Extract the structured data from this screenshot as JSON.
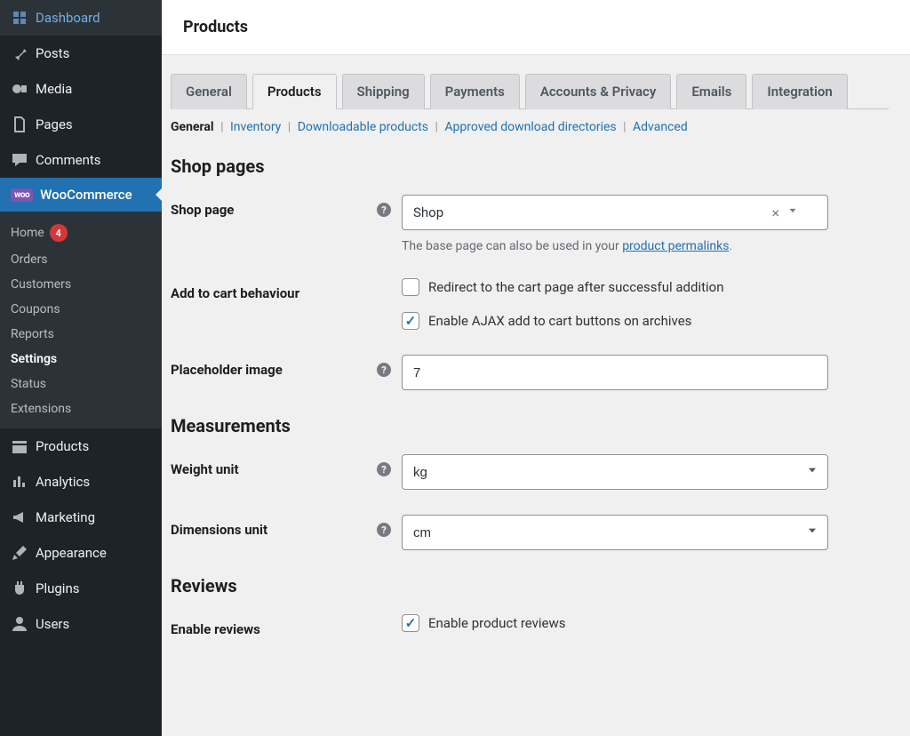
{
  "sidebar": {
    "items": [
      {
        "label": "Dashboard",
        "icon": "dashboard"
      },
      {
        "label": "Posts",
        "icon": "pin"
      },
      {
        "label": "Media",
        "icon": "media"
      },
      {
        "label": "Pages",
        "icon": "pages"
      },
      {
        "label": "Comments",
        "icon": "comment"
      },
      {
        "label": "WooCommerce",
        "icon": "woo",
        "active": true
      },
      {
        "label": "Products",
        "icon": "products"
      },
      {
        "label": "Analytics",
        "icon": "analytics"
      },
      {
        "label": "Marketing",
        "icon": "marketing"
      },
      {
        "label": "Appearance",
        "icon": "appearance"
      },
      {
        "label": "Plugins",
        "icon": "plugins"
      },
      {
        "label": "Users",
        "icon": "users"
      }
    ],
    "woo_badge": "woo",
    "submenu": {
      "home": "Home",
      "home_badge": "4",
      "orders": "Orders",
      "customers": "Customers",
      "coupons": "Coupons",
      "reports": "Reports",
      "settings": "Settings",
      "status": "Status",
      "extensions": "Extensions"
    }
  },
  "header": {
    "title": "Products"
  },
  "tabs": {
    "general": "General",
    "products": "Products",
    "shipping": "Shipping",
    "payments": "Payments",
    "accounts": "Accounts & Privacy",
    "emails": "Emails",
    "integration": "Integration"
  },
  "subnav": {
    "general": "General",
    "inventory": "Inventory",
    "downloadable": "Downloadable products",
    "approved": "Approved download directories",
    "advanced": "Advanced"
  },
  "sections": {
    "shop_pages": "Shop pages",
    "measurements": "Measurements",
    "reviews": "Reviews"
  },
  "fields": {
    "shop_page": {
      "label": "Shop page",
      "value": "Shop",
      "desc_pre": "The base page can also be used in your ",
      "desc_link": "product permalinks",
      "desc_post": "."
    },
    "add_to_cart": {
      "label": "Add to cart behaviour",
      "opt1": "Redirect to the cart page after successful addition",
      "opt2": "Enable AJAX add to cart buttons on archives"
    },
    "placeholder_image": {
      "label": "Placeholder image",
      "value": "7"
    },
    "weight_unit": {
      "label": "Weight unit",
      "value": "kg"
    },
    "dimensions_unit": {
      "label": "Dimensions unit",
      "value": "cm"
    },
    "enable_reviews": {
      "label": "Enable reviews",
      "opt1": "Enable product reviews"
    }
  }
}
